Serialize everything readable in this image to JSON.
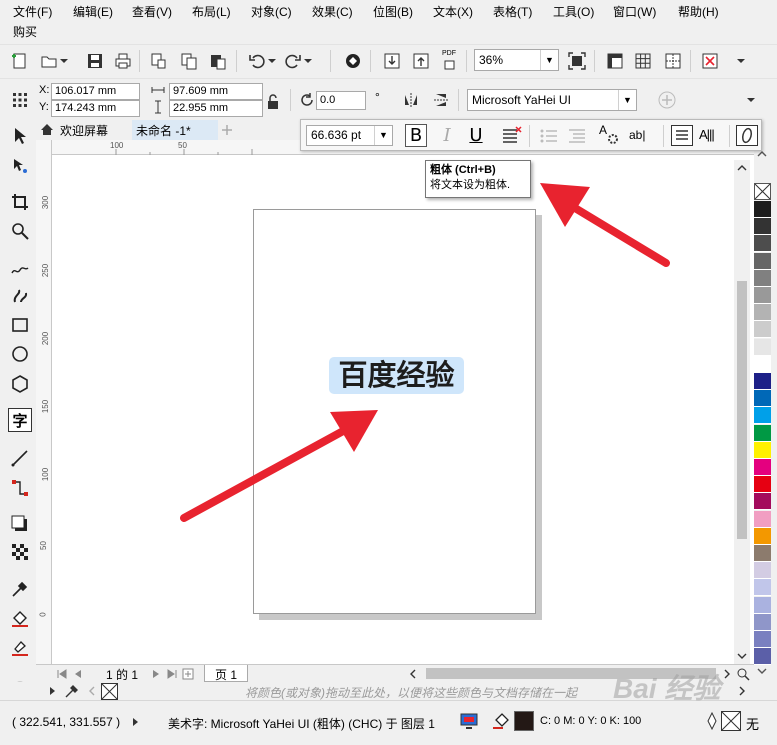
{
  "menu": {
    "items": [
      "文件(F)",
      "编辑(E)",
      "查看(V)",
      "布局(L)",
      "对象(C)",
      "效果(C)",
      "位图(B)",
      "文本(X)",
      "表格(T)",
      "工具(O)",
      "窗口(W)",
      "帮助(H)"
    ],
    "second_row": "购买"
  },
  "toolbar": {
    "zoom": "36%",
    "pdf_label": "PDF"
  },
  "property_bar": {
    "x_label": "X:",
    "x_value": "106.017 mm",
    "y_label": "Y:",
    "y_value": "174.243 mm",
    "width_value": "97.609 mm",
    "height_value": "22.955 mm",
    "rotation_value": "0.0",
    "degree_symbol": "°",
    "font_name": "Microsoft YaHei UI"
  },
  "tabs": {
    "welcome": "欢迎屏幕",
    "document": "未命名 -1*"
  },
  "ruler": {
    "h_ticks": [
      "100",
      "50"
    ],
    "v_ticks": [
      "300",
      "250",
      "200",
      "150",
      "100",
      "50",
      "0"
    ]
  },
  "text_toolbar": {
    "font_size": "66.636 pt",
    "bold_icon": "B",
    "italic_icon": "I",
    "underline_icon": "U",
    "case_icon": "A",
    "spacing_icon": "ab|",
    "vertical_icon": "A|||"
  },
  "tooltip": {
    "title": "粗体 (Ctrl+B)",
    "description": "将文本设为粗体."
  },
  "canvas": {
    "text": "百度经验"
  },
  "page_nav": {
    "page_count": "1 的 1",
    "page_tab": "页 1"
  },
  "doc_palette": {
    "hint": "将颜色(或对象)拖动至此处，以便将这些颜色与文档存储在一起"
  },
  "status": {
    "coords": "( 322.541, 331.557 )",
    "object_info": "美术字: Microsoft YaHei UI (粗体) (CHC) 于 图层 1",
    "fill_info": "C: 0 M: 0 Y: 0 K: 100",
    "outline_none": "无"
  },
  "watermark": {
    "text": "Bai 经验"
  },
  "colors": {
    "accent_red": "#e8232f",
    "selection_blue": "#cfe6fb",
    "palette": [
      "#1c1c1c",
      "#333333",
      "#4d4d4d",
      "#666666",
      "#808080",
      "#999999",
      "#b3b3b3",
      "#cccccc",
      "#e6e6e6",
      "#ffffff",
      "#1d2088",
      "#0068b7",
      "#00a0e9",
      "#009944",
      "#fff100",
      "#e4007f",
      "#e60012",
      "#a40b5d",
      "#f19ec2",
      "#f39800",
      "#8c7b6d",
      "#d3cce3",
      "#c1c6ea",
      "#aab2e0",
      "#8f96c9",
      "#7a80c0",
      "#5b5fa8"
    ]
  }
}
